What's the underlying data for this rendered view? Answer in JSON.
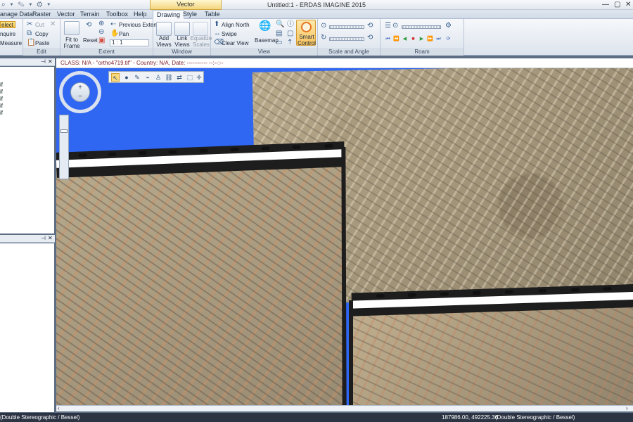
{
  "window": {
    "title": "Untitled:1 - ERDAS IMAGINE 2015",
    "contextual_tab": "Vector"
  },
  "tabs": [
    "anage Data",
    "Raster",
    "Vector",
    "Terrain",
    "Toolbox",
    "Help",
    "Drawing",
    "Style",
    "Table"
  ],
  "ribbon": {
    "select": "elect",
    "inquire": "nquire",
    "measure": "Measure",
    "edit": {
      "cut": "Cut",
      "copy": "Copy",
      "paste": "Paste",
      "label": "Edit"
    },
    "extent": {
      "fit_to_frame": "Fit to Frame",
      "reset": "Reset",
      "previous_extent": "Previous Extent",
      "pan": "Pan",
      "scale": "1 : 1",
      "label": "Extent"
    },
    "window": {
      "add_views": "Add Views",
      "link_views": "Link Views",
      "equalize_scales": "Equalize Scales",
      "label": "Window"
    },
    "view": {
      "align_north": "Align North",
      "swipe": "Swipe",
      "clear_view": "Clear View",
      "basemap": "Basemap",
      "smart_control": "Smart Control",
      "label": "View"
    },
    "scale_angle": {
      "label": "Scale and Angle"
    },
    "roam": {
      "label": "Roam"
    }
  },
  "left_panel": {
    "tree_items": [
      "",
      "if",
      "if",
      "if",
      "if",
      "if"
    ]
  },
  "view": {
    "info": "CLASS: N/A - \"ortho4719.tif\" - Country: N/A, Date: ----------- --:--:--"
  },
  "status": {
    "left": "(Double Stereographic / Bessel)",
    "coords": "187986.00, 492225.36",
    "projection": "(Double Stereographic / Bessel)"
  }
}
